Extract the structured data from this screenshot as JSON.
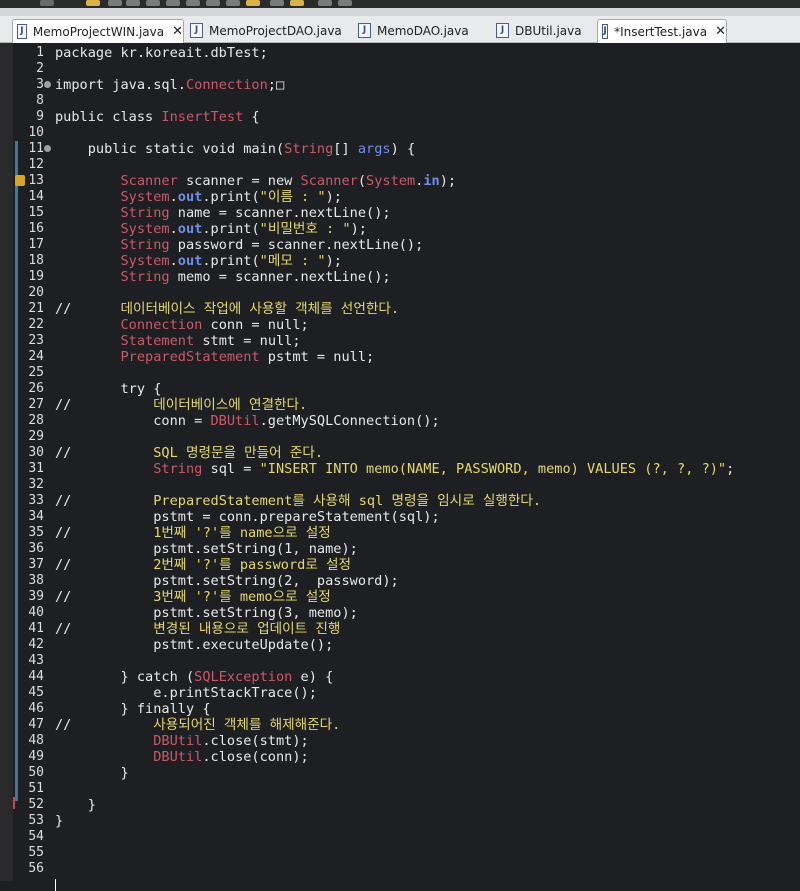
{
  "tabs": [
    {
      "label": "MemoProjectWIN.java",
      "active": true,
      "closable": true
    },
    {
      "label": "MemoProjectDAO.java",
      "active": false,
      "closable": false
    },
    {
      "label": "MemoDAO.java",
      "active": false,
      "closable": false
    },
    {
      "label": "DBUtil.java",
      "active": false,
      "closable": false
    },
    {
      "label": "*InsertTest.java",
      "active": true,
      "closable": true
    }
  ],
  "tab_close_glyph": "✕",
  "colors": {
    "background": "#1e1f22",
    "keyword": "#e8e8e8",
    "type": "#c85a6a",
    "string": "#e5d86a",
    "field": "#6d8ee8",
    "comment": "#e5d86a"
  },
  "line_numbers": [
    "1",
    "2",
    "3",
    "8",
    "9",
    "10",
    "11",
    "12",
    "13",
    "14",
    "15",
    "16",
    "17",
    "18",
    "19",
    "20",
    "21",
    "22",
    "23",
    "24",
    "25",
    "26",
    "27",
    "28",
    "29",
    "30",
    "31",
    "32",
    "33",
    "34",
    "35",
    "36",
    "37",
    "38",
    "39",
    "40",
    "41",
    "42",
    "43",
    "44",
    "45",
    "46",
    "47",
    "48",
    "49",
    "50",
    "51",
    "52",
    "53",
    "54",
    "55",
    "56"
  ],
  "code_lines": [
    "package kr.koreait.dbTest;",
    "",
    "import java.sql.Connection;□",
    "",
    "public class InsertTest {",
    "",
    "    public static void main(String[] args) {",
    "",
    "        Scanner scanner = new Scanner(System.in);",
    "        System.out.print(\"이름 : \");",
    "        String name = scanner.nextLine();",
    "        System.out.print(\"비밀번호 : \");",
    "        String password = scanner.nextLine();",
    "        System.out.print(\"메모 : \");",
    "        String memo = scanner.nextLine();",
    "",
    "//      데이터베이스 작업에 사용할 객체를 선언한다.",
    "        Connection conn = null;",
    "        Statement stmt = null;",
    "        PreparedStatement pstmt = null;",
    "",
    "        try {",
    "//          데이터베이스에 연결한다.",
    "            conn = DBUtil.getMySQLConnection();",
    "",
    "//          SQL 명령문을 만들어 준다.",
    "            String sql = \"INSERT INTO memo(NAME, PASSWORD, memo) VALUES (?, ?, ?)\";",
    "",
    "//          PreparedStatement를 사용해 sql 명령을 임시로 실행한다.",
    "            pstmt = conn.prepareStatement(sql);",
    "//          1번째 '?'를 name으로 설정",
    "            pstmt.setString(1, name);",
    "//          2번째 '?'를 password로 설정",
    "            pstmt.setString(2,  password);",
    "//          3번째 '?'를 memo으로 설정",
    "            pstmt.setString(3, memo);",
    "//          변경된 내용으로 업데이트 진행",
    "            pstmt.executeUpdate();",
    "",
    "        } catch (SQLException e) {",
    "            e.printStackTrace();",
    "        } finally {",
    "//          사용되어진 객체를 해제해준다.",
    "            DBUtil.close(stmt);",
    "            DBUtil.close(conn);",
    "        }",
    "",
    "    }",
    "}",
    "",
    "",
    ""
  ]
}
